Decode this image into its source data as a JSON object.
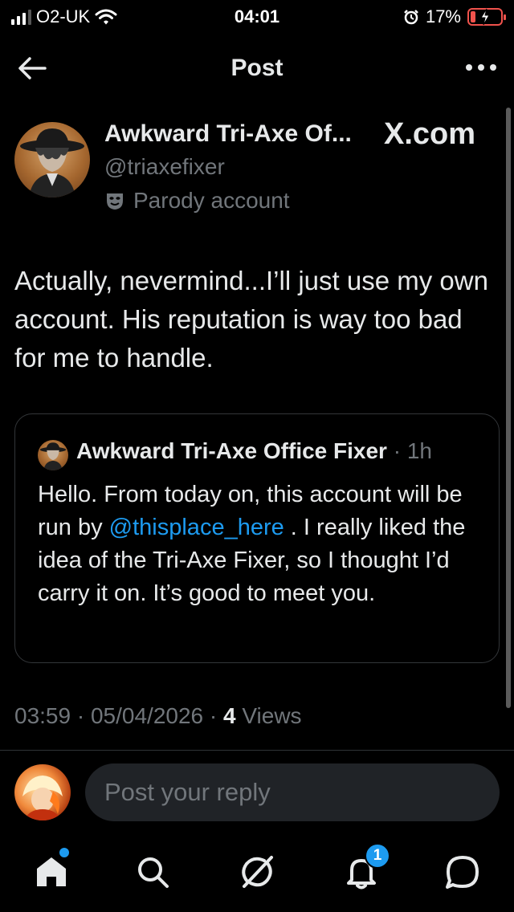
{
  "status_bar": {
    "carrier": "O2-UK",
    "time": "04:01",
    "battery": "17%",
    "battery_level": 0.17
  },
  "header": {
    "title": "Post"
  },
  "post": {
    "author_name": "Awkward Tri-Axe Of...",
    "source_logo": "X.com",
    "handle": "@triaxefixer",
    "label": "Parody account",
    "text": "Actually, nevermind...I’ll just use my own account. His reputation is way too bad for me to handle.",
    "time": "03:59",
    "date": "05/04/2026",
    "views_count": "4",
    "views_label": "Views"
  },
  "quote": {
    "author_name": "Awkward Tri-Axe Office Fixer",
    "time": "1h",
    "text_before": "Hello. From today on, this account will be run by ",
    "mention": "@thisplace_here",
    "text_after": " . I really liked the idea of the Tri-Axe Fixer, so I thought I’d carry it on. It’s good to meet you."
  },
  "reply": {
    "placeholder": "Post your reply"
  },
  "tabbar": {
    "items": [
      "home-icon",
      "search-icon",
      "grok-icon",
      "notifications-icon",
      "messages-icon"
    ],
    "notifications_badge": "1"
  },
  "colors": {
    "accent": "#1d9bf0",
    "secondary_text": "#71767b",
    "battery_low": "#f0524c"
  }
}
